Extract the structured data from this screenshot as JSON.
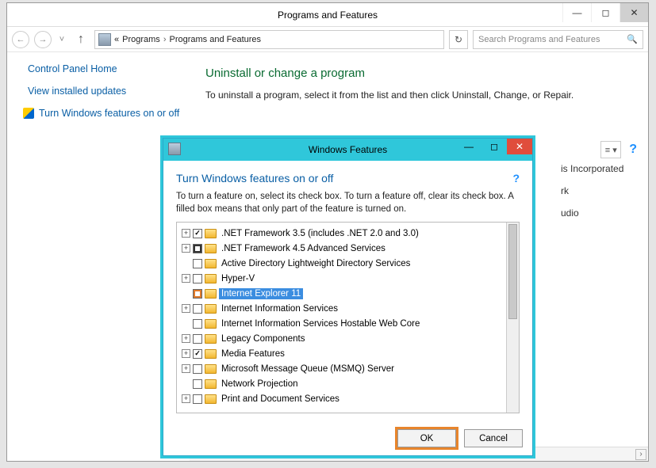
{
  "main": {
    "title": "Programs and Features",
    "breadcrumb": {
      "chev": "«",
      "a": "Programs",
      "b": "Programs and Features"
    },
    "search_placeholder": "Search Programs and Features"
  },
  "sidebar": {
    "items": [
      {
        "label": "Control Panel Home",
        "shield": false
      },
      {
        "label": "View installed updates",
        "shield": false
      },
      {
        "label": "Turn Windows features on or off",
        "shield": true
      }
    ]
  },
  "content": {
    "heading": "Uninstall or change a program",
    "instruction": "To uninstall a program, select it from the list and then click Uninstall, Change, or Repair."
  },
  "right_panel": {
    "a": "is Incorporated",
    "b": "rk",
    "c": "udio"
  },
  "dialog": {
    "title": "Windows Features",
    "heading": "Turn Windows features on or off",
    "instruction": "To turn a feature on, select its check box. To turn a feature off, clear its check box. A filled box means that only part of the feature is turned on.",
    "ok_label": "OK",
    "cancel_label": "Cancel",
    "features": [
      {
        "expander": "+",
        "chk": "checked",
        "label": ".NET Framework 3.5 (includes .NET 2.0 and 3.0)",
        "selected": false
      },
      {
        "expander": "+",
        "chk": "partial-dark",
        "label": ".NET Framework 4.5 Advanced Services",
        "selected": false
      },
      {
        "expander": "",
        "chk": "",
        "label": "Active Directory Lightweight Directory Services",
        "selected": false
      },
      {
        "expander": "+",
        "chk": "",
        "label": "Hyper-V",
        "selected": false
      },
      {
        "expander": "",
        "chk": "partial",
        "label": "Internet Explorer 11",
        "selected": true
      },
      {
        "expander": "+",
        "chk": "",
        "label": "Internet Information Services",
        "selected": false
      },
      {
        "expander": "",
        "chk": "",
        "label": "Internet Information Services Hostable Web Core",
        "selected": false
      },
      {
        "expander": "+",
        "chk": "",
        "label": "Legacy Components",
        "selected": false
      },
      {
        "expander": "+",
        "chk": "checked",
        "label": "Media Features",
        "selected": false
      },
      {
        "expander": "+",
        "chk": "",
        "label": "Microsoft Message Queue (MSMQ) Server",
        "selected": false
      },
      {
        "expander": "",
        "chk": "",
        "label": "Network Projection",
        "selected": false
      },
      {
        "expander": "+",
        "chk": "",
        "label": "Print and Document Services",
        "selected": false
      }
    ]
  }
}
